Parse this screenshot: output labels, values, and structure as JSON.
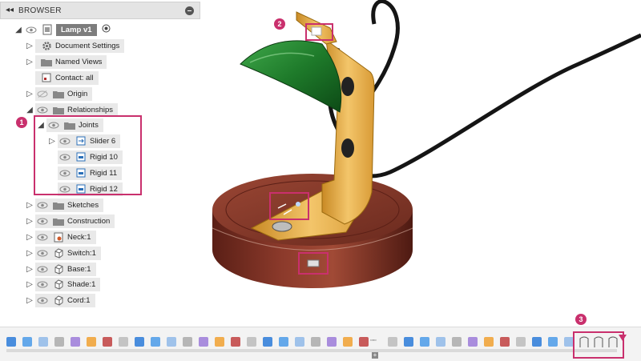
{
  "browser": {
    "title": "BROWSER",
    "root": "Lamp v1",
    "items": [
      {
        "label": "Document Settings"
      },
      {
        "label": "Named Views"
      },
      {
        "label": "Contact: all"
      },
      {
        "label": "Origin"
      },
      {
        "label": "Relationships"
      },
      {
        "label": "Joints"
      },
      {
        "label": "Slider 6"
      },
      {
        "label": "Rigid 10"
      },
      {
        "label": "Rigid 11"
      },
      {
        "label": "Rigid 12"
      },
      {
        "label": "Sketches"
      },
      {
        "label": "Construction"
      },
      {
        "label": "Neck:1"
      },
      {
        "label": "Switch:1"
      },
      {
        "label": "Base:1"
      },
      {
        "label": "Shade:1"
      },
      {
        "label": "Cord:1"
      }
    ]
  },
  "callouts": [
    "1",
    "2",
    "3"
  ],
  "colors": {
    "accent": "#c9306d",
    "shade_green": "#1e7a2a",
    "brass": "#e0a840",
    "wood": "#7a3024"
  },
  "timeline": {
    "plus": "+",
    "dots": "▫▫▫"
  }
}
